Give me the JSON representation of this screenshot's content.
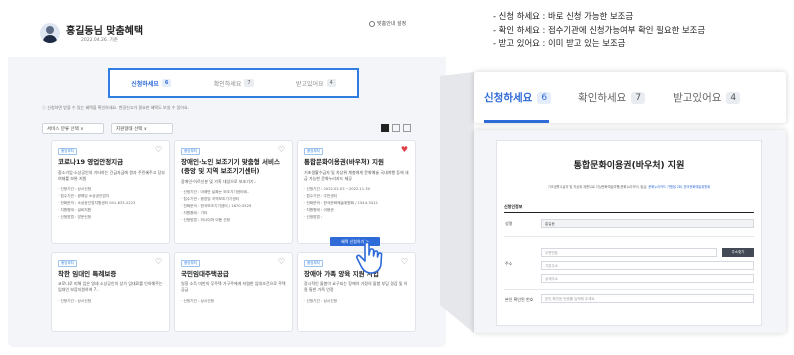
{
  "app": {
    "user_name": "홍길동님 맞춤혜택",
    "user_date": "2022.04.26. 기준",
    "top_link": "맞춤안내 설정",
    "tabs": [
      {
        "label": "신청하세요",
        "count": "6"
      },
      {
        "label": "확인하세요",
        "count": "7"
      },
      {
        "label": "받고있어요",
        "count": "4"
      }
    ],
    "notice": "ⓘ 신청하면 받을 수 있는 혜택을 확인하세요. 변경신고가 필요한 혜택도 보실 수 있어요.",
    "filters": [
      "서비스 분류 선택 ∨",
      "지원형태 선택 ∨"
    ],
    "cards": [
      {
        "tag": "중앙부처",
        "title": "코로나19 영업안정지금",
        "desc": "중소기업·소상공인의 기타하는 긴급자금에 원자 주민혜주고 당부 여재를 보완 지원",
        "meta": [
          "· 신청기간 : 상시신청",
          "· 접수기관 : 광해임 소상공인업자",
          "· 전화문의 : 소상공인업지원센터 041-633-2223",
          "· 지원형태 : 설비지원",
          "· 신청방법 : 방문신청"
        ]
      },
      {
        "tag": "중앙부처",
        "title": "장애인·노인 보조기기 맞춤형 서비스 (중앙 및 지역 보조기기센터)",
        "desc": "장애인·어르신분 및 가족 대상으로 보조기기..",
        "meta": [
          "· 신청기간 : 아래만 날짜는 보조기기센터에..",
          "· 접수기관 : 중앙및 지역보조기기센터",
          "· 전화문의 : 한국보조기기센터 / 1670-5529",
          "· 지원형태 : 기타",
          "· 신청방법 : 하나이마 이용 신청"
        ]
      },
      {
        "tag": "중앙부처",
        "title": "통합문화이용권(바우처) 지원",
        "desc": "기초생활수급자 및 차상위 계층에게 문화예술 국내여행 등에 세금 가능한 문화누리카드 제공",
        "meta": [
          "· 신청기간 : 2022.02.03 ~2022.11.30",
          "· 접수기관 : 주민센터",
          "· 전화문의 : 한국문화예술위원회 / 1544-3412",
          "· 지원형태 : 이용권",
          "· 신청방법 :"
        ]
      },
      {
        "tag": "중앙부처",
        "title": "착한 임대인 특례보증",
        "desc": "코로나로 피해 입은 영세 소상공인의 상가 임대료를 인하해주는 임대인 보증지원하여 7..",
        "meta": [
          "· 신청기간 : 상시신청"
        ]
      },
      {
        "tag": "중앙부처",
        "title": "국민임대주택공급",
        "desc": "일정 소득 미만의 무주택 가구주에게 저렴한 임대조건으로 주택 공급",
        "meta": [
          "· 신청기간 : 상시신청"
        ]
      },
      {
        "tag": "중앙부처",
        "title": "장애아 가족 양육 지원 사업",
        "desc": "장시적인 돌봄이 요구되는 장애아 가정의 돌봄 부담 경감 및 이용 통한 가족 안정",
        "meta": [
          "· 신청기간 : 상시신청"
        ]
      }
    ],
    "apply_button": "혜택 신청하기 >"
  },
  "legend": [
    "- 신청 하세요 : 바로 신청 가능한 보조금",
    "- 확인 하세요 : 접수기관에 신청가능여부 확인 필요한 보조금",
    "- 받고 있어요 : 이미 받고 있는 보조금"
  ],
  "zoom_tabs": [
    {
      "label": "신청하세요",
      "count": "6"
    },
    {
      "label": "확인하세요",
      "count": "7"
    },
    {
      "label": "받고있어요",
      "count": "4"
    }
  ],
  "detail": {
    "title": "통합문화이용권(바우처) 지원",
    "desc": "기초생활수급자 및 차상위 계층으로 이상문화예술여행(문화누리카드) 발급,",
    "desc_link": "문화누리카드 가맹점 2회, 한국문화예술위원회",
    "section": "신청인정보",
    "name_label": "성명",
    "name_value": "홍길동",
    "address_label": "주소",
    "address_placeholder1": "우편번호",
    "address_placeholder2": "기본주소",
    "address_placeholder3": "상세주소",
    "search_button": "주소찾기",
    "id_label": "본인 확인된 번호",
    "id_placeholder": "본인 확인된 번호를 입력해 주세요"
  },
  "colors": {
    "accent": "#2f6bd8",
    "highlight_border": "#2f7de1",
    "heart_active": "#e0414a"
  }
}
